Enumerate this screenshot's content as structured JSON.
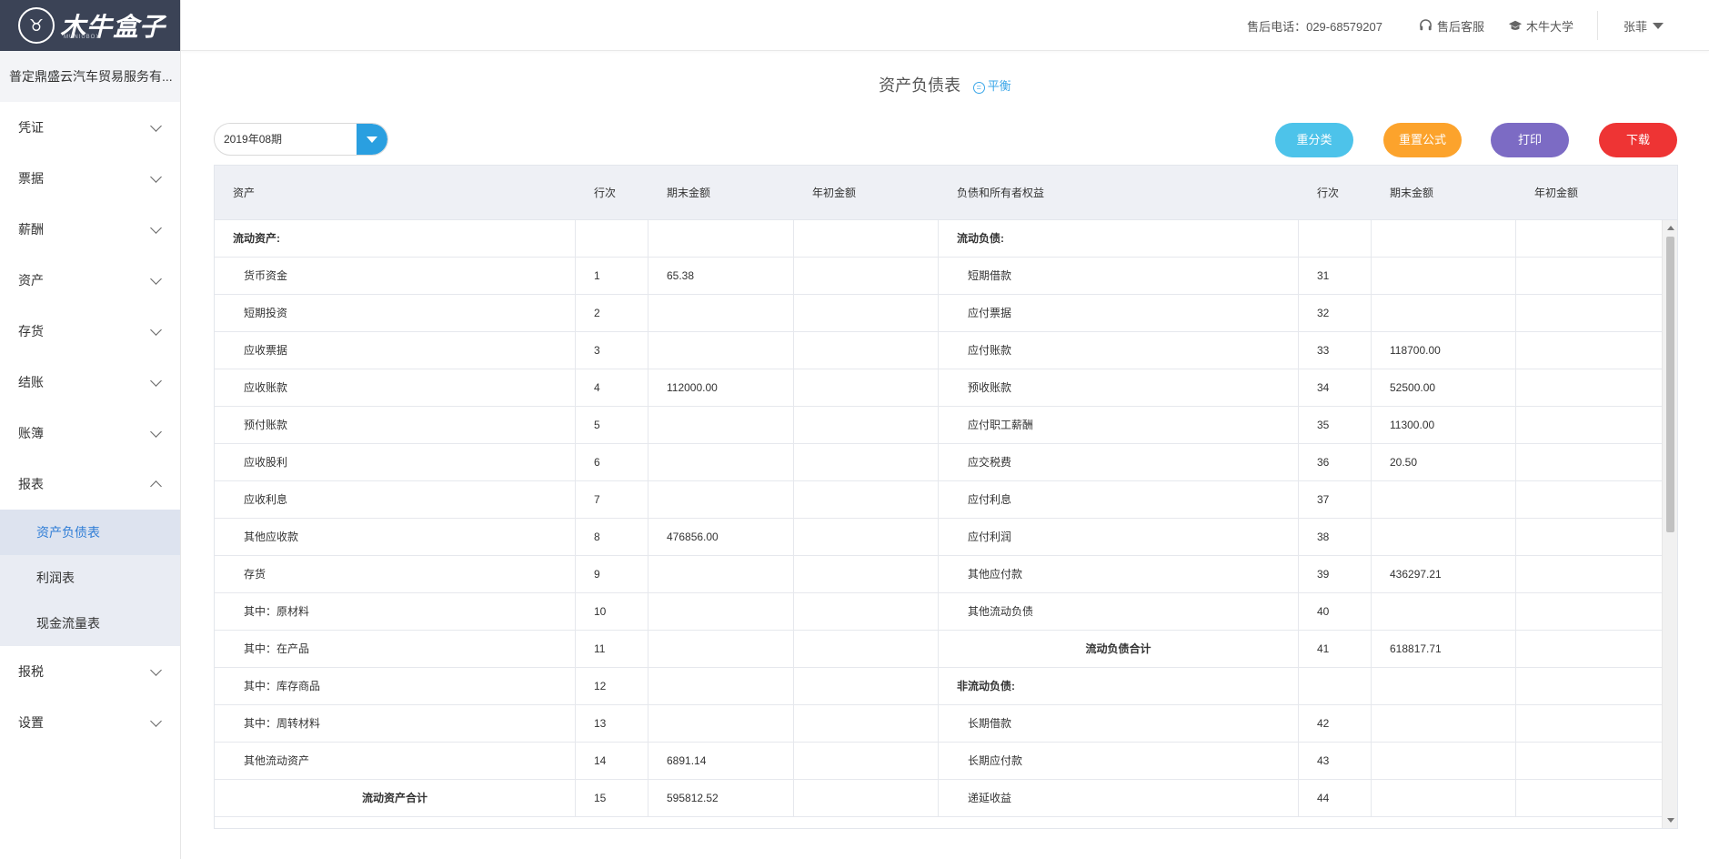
{
  "brand": {
    "name": "木牛盒子",
    "sub": "MUNIUBOX"
  },
  "company": "普定鼎盛云汽车贸易服务有...",
  "sidebar": {
    "items": [
      {
        "label": "凭证"
      },
      {
        "label": "票据"
      },
      {
        "label": "薪酬"
      },
      {
        "label": "资产"
      },
      {
        "label": "存货"
      },
      {
        "label": "结账"
      },
      {
        "label": "账簿"
      },
      {
        "label": "报表"
      }
    ],
    "sub": [
      {
        "label": "资产负债表"
      },
      {
        "label": "利润表"
      },
      {
        "label": "现金流量表"
      }
    ],
    "after": [
      {
        "label": "报税"
      },
      {
        "label": "设置"
      }
    ]
  },
  "topbar": {
    "hotline": "售后电话：029-68579207",
    "service": "售后客服",
    "university": "木牛大学",
    "user": "张菲"
  },
  "page": {
    "title": "资产负债表",
    "balance": "平衡",
    "period": "2019年08期"
  },
  "buttons": {
    "reclassify": "重分类",
    "reset_formula": "重置公式",
    "print": "打印",
    "download": "下载"
  },
  "colors": {
    "reclassify": "#4dc3ea",
    "reset_formula": "#fca32c",
    "print": "#7c6bc4",
    "download": "#ee3434",
    "accent": "#2a9fe0"
  },
  "table": {
    "headers": [
      "资产",
      "行次",
      "期末金额",
      "年初金额",
      "负债和所有者权益",
      "行次",
      "期末金额",
      "年初金额"
    ],
    "rows": [
      [
        "流动资产:",
        "",
        "",
        "",
        "流动负债:",
        "",
        "",
        ""
      ],
      [
        "货币资金",
        "1",
        "65.38",
        "",
        "短期借款",
        "31",
        "",
        ""
      ],
      [
        "短期投资",
        "2",
        "",
        "",
        "应付票据",
        "32",
        "",
        ""
      ],
      [
        "应收票据",
        "3",
        "",
        "",
        "应付账款",
        "33",
        "118700.00",
        ""
      ],
      [
        "应收账款",
        "4",
        "112000.00",
        "",
        "预收账款",
        "34",
        "52500.00",
        ""
      ],
      [
        "预付账款",
        "5",
        "",
        "",
        "应付职工薪酬",
        "35",
        "11300.00",
        ""
      ],
      [
        "应收股利",
        "6",
        "",
        "",
        "应交税费",
        "36",
        "20.50",
        ""
      ],
      [
        "应收利息",
        "7",
        "",
        "",
        "应付利息",
        "37",
        "",
        ""
      ],
      [
        "其他应收款",
        "8",
        "476856.00",
        "",
        "应付利润",
        "38",
        "",
        ""
      ],
      [
        "存货",
        "9",
        "",
        "",
        "其他应付款",
        "39",
        "436297.21",
        ""
      ],
      [
        "其中：原材料",
        "10",
        "",
        "",
        "其他流动负债",
        "40",
        "",
        ""
      ],
      [
        "其中：在产品",
        "11",
        "",
        "",
        "流动负债合计",
        "41",
        "618817.71",
        ""
      ],
      [
        "其中：库存商品",
        "12",
        "",
        "",
        "非流动负债:",
        "",
        "",
        ""
      ],
      [
        "其中：周转材料",
        "13",
        "",
        "",
        "长期借款",
        "42",
        "",
        ""
      ],
      [
        "其他流动资产",
        "14",
        "6891.14",
        "",
        "长期应付款",
        "43",
        "",
        ""
      ],
      [
        "流动资产合计",
        "15",
        "595812.52",
        "",
        "递延收益",
        "44",
        "",
        ""
      ]
    ],
    "row_styles_left": [
      "bold",
      "indent",
      "indent",
      "indent",
      "indent",
      "indent",
      "indent",
      "indent",
      "indent",
      "indent",
      "indent",
      "indent",
      "indent",
      "indent",
      "indent",
      "boldcenter"
    ],
    "row_styles_right": [
      "bold",
      "indent",
      "indent",
      "indent",
      "indent",
      "indent",
      "indent",
      "indent",
      "indent",
      "indent",
      "indent",
      "boldcenter",
      "bold",
      "indent",
      "indent",
      "indent"
    ]
  }
}
